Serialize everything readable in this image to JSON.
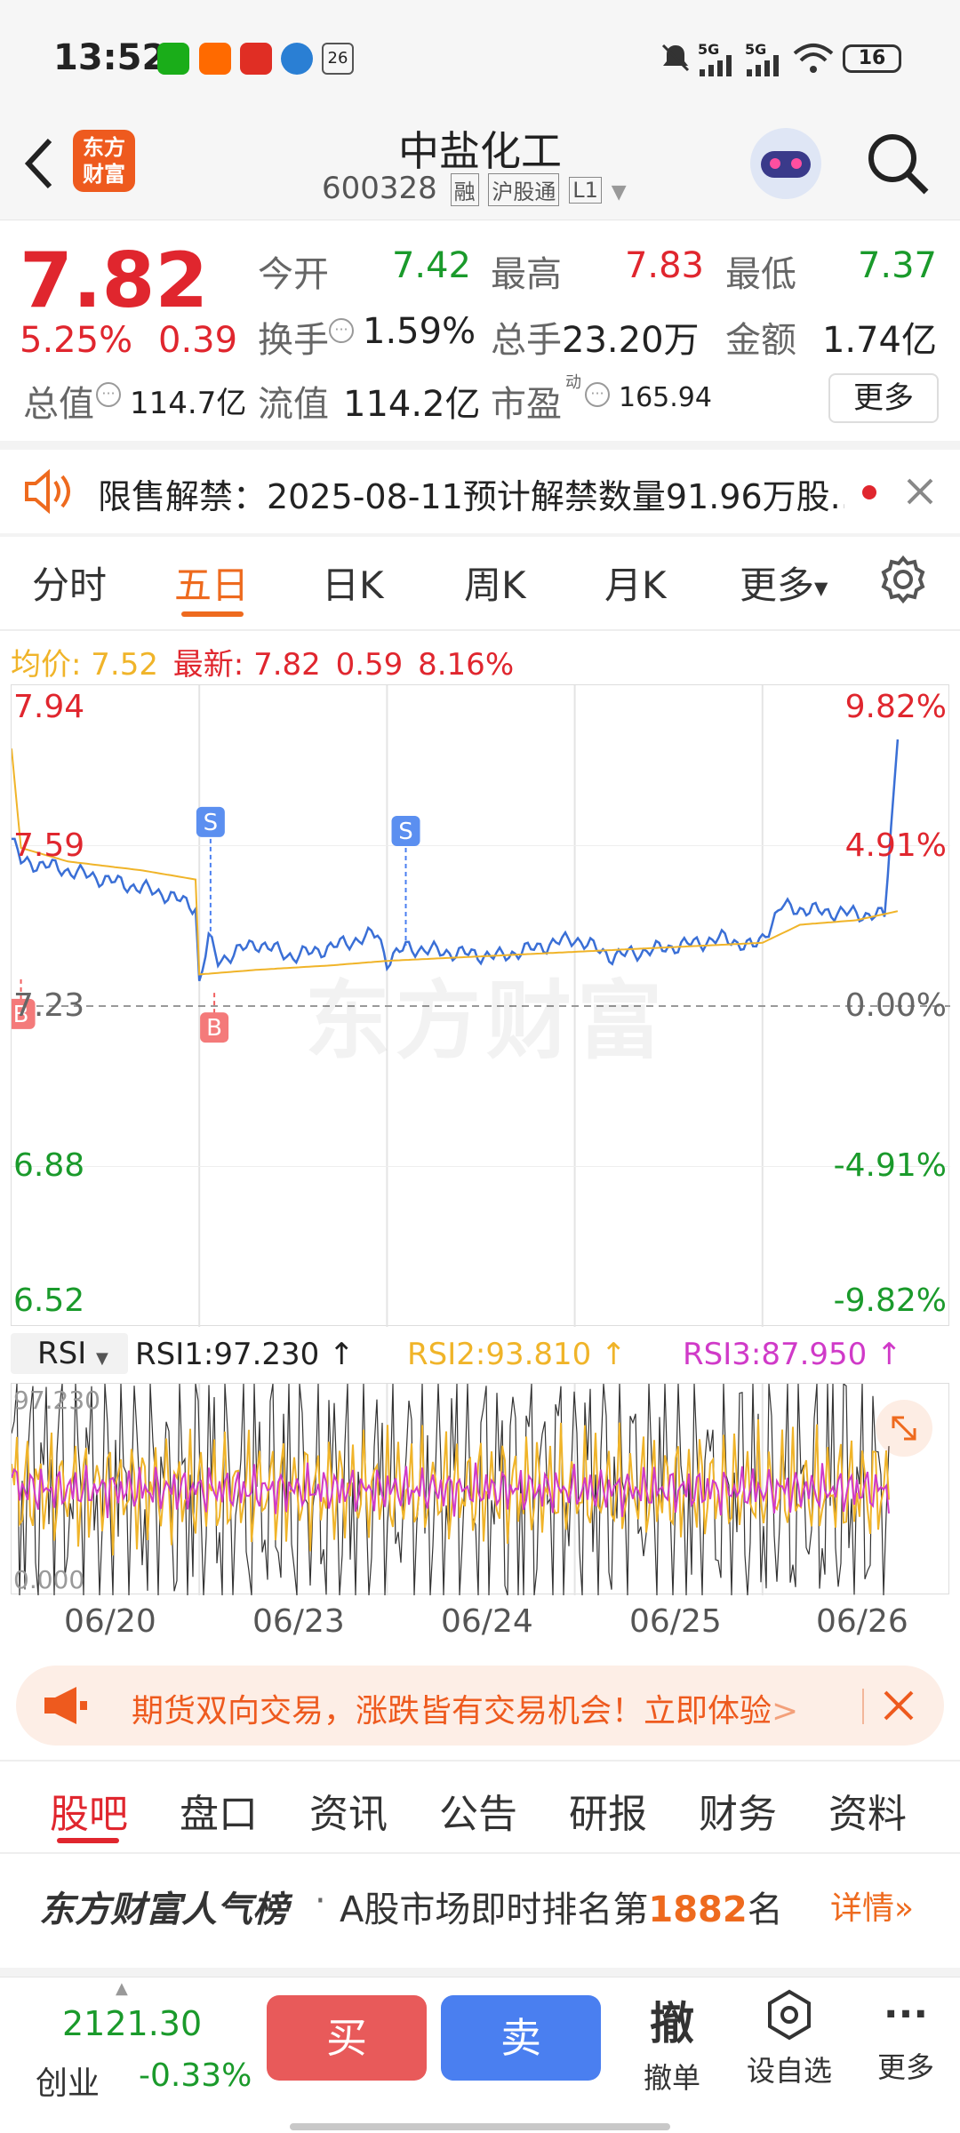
{
  "status": {
    "time": "13:52",
    "battery": "16",
    "signal1": "5G",
    "signal2": "5G",
    "app_icons": [
      "wechat-icon",
      "taobao-icon",
      "pinduoduo-icon",
      "telecom-icon",
      "calendar-icon"
    ],
    "calendar_day": "26"
  },
  "header": {
    "title": "中盐化工",
    "code": "600328",
    "badges": [
      "融",
      "沪股通",
      "L1"
    ],
    "logo_text_1": "东方",
    "logo_text_2": "财富"
  },
  "quote": {
    "price": "7.82",
    "change_pct": "5.25%",
    "change": "0.39",
    "fields": [
      {
        "label": "今开",
        "value": "7.42",
        "color": "green"
      },
      {
        "label": "最高",
        "value": "7.83",
        "color": "red"
      },
      {
        "label": "最低",
        "value": "7.37",
        "color": "green"
      },
      {
        "label": "换手",
        "value": "1.59%",
        "color": "dark"
      },
      {
        "label": "总手",
        "value": "23.20万",
        "color": "dark"
      },
      {
        "label": "金额",
        "value": "1.74亿",
        "color": "dark"
      },
      {
        "label": "总值",
        "value": "114.7亿",
        "color": "dark"
      },
      {
        "label": "流值",
        "value": "114.2亿",
        "color": "dark"
      },
      {
        "label": "市盈",
        "value": "165.94",
        "color": "dark"
      }
    ],
    "pe_superscript": "动",
    "more_label": "更多"
  },
  "notice": {
    "text": "限售解禁：2025-08-11预计解禁数量91.96万股..."
  },
  "chart_tabs": [
    "分时",
    "五日",
    "日K",
    "周K",
    "月K",
    "更多"
  ],
  "active_tab": "五日",
  "summary": {
    "avg_label": "均价:",
    "avg_value": "7.52",
    "latest_label": "最新:",
    "latest_value": "7.82",
    "latest_change": "0.59",
    "latest_pct": "8.16%"
  },
  "watermark": "东方财富",
  "rsi": {
    "selector": "RSI",
    "rsi1": "RSI1:97.230 ↑",
    "rsi2": "RSI2:93.810 ↑",
    "rsi3": "RSI3:87.950 ↑",
    "top_label": "97.230",
    "bottom_label": "0.000"
  },
  "chart_data": {
    "type": "line",
    "title": "",
    "x_days": [
      "06/20",
      "06/23",
      "06/24",
      "06/25",
      "06/26"
    ],
    "y_ticks_left": [
      "7.94",
      "7.59",
      "7.23",
      "6.88",
      "6.52"
    ],
    "y_ticks_right": [
      "9.82%",
      "4.91%",
      "0.00%",
      "-4.91%",
      "-9.82%"
    ],
    "ylim": [
      6.52,
      7.94
    ],
    "prev_close": 7.23,
    "series": [
      {
        "name": "最新",
        "color": "#3a6fd6",
        "points": [
          [
            0.0,
            7.6
          ],
          [
            0.05,
            7.55
          ],
          [
            0.2,
            7.54
          ],
          [
            0.4,
            7.52
          ],
          [
            0.6,
            7.5
          ],
          [
            0.8,
            7.48
          ],
          [
            0.98,
            7.45
          ],
          [
            1.0,
            7.28
          ],
          [
            1.05,
            7.38
          ],
          [
            1.1,
            7.33
          ],
          [
            1.3,
            7.37
          ],
          [
            1.5,
            7.34
          ],
          [
            1.7,
            7.36
          ],
          [
            1.95,
            7.39
          ],
          [
            2.0,
            7.33
          ],
          [
            2.1,
            7.36
          ],
          [
            2.3,
            7.35
          ],
          [
            2.6,
            7.34
          ],
          [
            2.8,
            7.36
          ],
          [
            3.0,
            7.38
          ],
          [
            3.05,
            7.37
          ],
          [
            3.2,
            7.34
          ],
          [
            3.5,
            7.36
          ],
          [
            3.8,
            7.38
          ],
          [
            3.95,
            7.36
          ],
          [
            4.0,
            7.38
          ],
          [
            4.1,
            7.45
          ],
          [
            4.3,
            7.44
          ],
          [
            4.65,
            7.43
          ],
          [
            4.72,
            7.82
          ]
        ]
      },
      {
        "name": "均价",
        "color": "#f0b429",
        "points": [
          [
            0.0,
            7.8
          ],
          [
            0.05,
            7.58
          ],
          [
            0.3,
            7.55
          ],
          [
            0.7,
            7.53
          ],
          [
            0.98,
            7.51
          ],
          [
            1.0,
            7.3
          ],
          [
            1.3,
            7.31
          ],
          [
            1.7,
            7.32
          ],
          [
            2.0,
            7.33
          ],
          [
            2.5,
            7.34
          ],
          [
            3.0,
            7.35
          ],
          [
            3.5,
            7.36
          ],
          [
            4.0,
            7.37
          ],
          [
            4.2,
            7.41
          ],
          [
            4.5,
            7.42
          ],
          [
            4.72,
            7.44
          ]
        ]
      }
    ],
    "markers": [
      {
        "label": "B",
        "day": 0.05,
        "price": 7.25
      },
      {
        "label": "S",
        "day": 1.06,
        "price": 7.6
      },
      {
        "label": "B",
        "day": 1.08,
        "price": 7.22
      },
      {
        "label": "S",
        "day": 2.1,
        "price": 7.58
      }
    ]
  },
  "promo": {
    "text": "期货双向交易，涨跌皆有交易机会！立即体验",
    "arrow": ">"
  },
  "bottom_tabs": [
    "股吧",
    "盘口",
    "资讯",
    "公告",
    "研报",
    "财务",
    "资料"
  ],
  "active_bottom_tab": "股吧",
  "ranking": {
    "brand": "东方财富人气榜",
    "dot": "·",
    "text_prefix": "A股市场即时排名第",
    "rank": "1882",
    "text_suffix": "名",
    "details": "详情"
  },
  "footer": {
    "index_value": "2121.30",
    "index_name": "创业",
    "index_change": "-0.33%",
    "buy": "买",
    "sell": "卖",
    "cancel_icon_text": "撤",
    "cancel_label": "撤单",
    "watch_label": "设自选",
    "more_label": "更多"
  },
  "colors": {
    "red": "#e0262e",
    "green": "#1a9a2b",
    "orange": "#ee6a1e",
    "buy_button": "#e85a5a",
    "sell_button": "#4a7ff0",
    "price_line": "#3a6fd6",
    "avg_line": "#f0b429"
  }
}
